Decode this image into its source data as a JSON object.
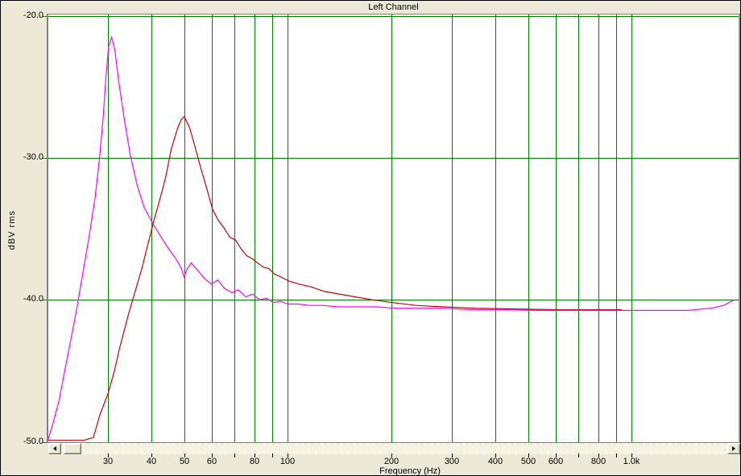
{
  "window": {
    "title": "Left Channel"
  },
  "colors": {
    "background": "#ece9d8",
    "plot_background": "#ffffff",
    "grid": "#008000",
    "frame": "#808080",
    "trace_magenta": "#ff00ff",
    "trace_red": "#cc0000",
    "text": "#000000"
  },
  "axes": {
    "y_label": "dBV rms",
    "x_label": "Frequency (Hz)",
    "y_ticks": [
      {
        "value": -20,
        "label": "-20.0"
      },
      {
        "value": -30,
        "label": "-30.0"
      },
      {
        "value": -40,
        "label": "-40.0"
      },
      {
        "value": -50,
        "label": "-50.0"
      }
    ],
    "x_gridlines": [
      30,
      40,
      50,
      60,
      70,
      80,
      90,
      100,
      200,
      300,
      400,
      500,
      600,
      700,
      800,
      900,
      1000
    ],
    "x_tick_labels": [
      {
        "f": 30,
        "label": "30"
      },
      {
        "f": 40,
        "label": "40"
      },
      {
        "f": 50,
        "label": "50"
      },
      {
        "f": 60,
        "label": "60"
      },
      {
        "f": 80,
        "label": "80"
      },
      {
        "f": 100,
        "label": "100"
      },
      {
        "f": 200,
        "label": "200"
      },
      {
        "f": 300,
        "label": "300"
      },
      {
        "f": 400,
        "label": "400"
      },
      {
        "f": 500,
        "label": "500"
      },
      {
        "f": 600,
        "label": "600"
      },
      {
        "f": 800,
        "label": "800"
      },
      {
        "f": 1000,
        "label": "1.0k"
      }
    ]
  },
  "scrollbar": {
    "left_arrow_icon": "scrollbar-left-arrow-icon",
    "right_arrow_icon": "scrollbar-right-arrow-icon"
  },
  "chart_data": {
    "type": "line",
    "title": "Left Channel",
    "xlabel": "Frequency (Hz)",
    "ylabel": "dBV rms",
    "xscale": "log",
    "xlim": [
      20,
      2000
    ],
    "ylim": [
      -50,
      -20
    ],
    "grid": true,
    "series": [
      {
        "name": "red-trace (50 Hz peak)",
        "color": "#cc0000",
        "points": [
          [
            20,
            -49.9
          ],
          [
            23,
            -49.9
          ],
          [
            25.5,
            -49.9
          ],
          [
            27.2,
            -49.7
          ],
          [
            28.4,
            -48.1
          ],
          [
            30,
            -46.6
          ],
          [
            31.3,
            -45.0
          ],
          [
            32.4,
            -43.4
          ],
          [
            34.4,
            -41.0
          ],
          [
            37.6,
            -37.8
          ],
          [
            40.6,
            -34.6
          ],
          [
            43,
            -32.4
          ],
          [
            44.1,
            -31.4
          ],
          [
            45.8,
            -29.4
          ],
          [
            47.8,
            -27.9
          ],
          [
            49,
            -27.3
          ],
          [
            50,
            -27.1
          ],
          [
            51.8,
            -27.9
          ],
          [
            53.5,
            -29.1
          ],
          [
            55.6,
            -30.6
          ],
          [
            58,
            -32.1
          ],
          [
            60.3,
            -33.6
          ],
          [
            62.7,
            -34.4
          ],
          [
            65,
            -34.9
          ],
          [
            67.8,
            -35.6
          ],
          [
            70.5,
            -35.8
          ],
          [
            73,
            -36.4
          ],
          [
            75.9,
            -36.9
          ],
          [
            78.7,
            -37.1
          ],
          [
            81.5,
            -37.4
          ],
          [
            84.7,
            -37.7
          ],
          [
            88,
            -37.8
          ],
          [
            91.5,
            -38.2
          ],
          [
            95.5,
            -38.4
          ],
          [
            101,
            -38.7
          ],
          [
            108,
            -38.9
          ],
          [
            117,
            -39.1
          ],
          [
            127,
            -39.4
          ],
          [
            141,
            -39.6
          ],
          [
            157,
            -39.8
          ],
          [
            176,
            -40.0
          ],
          [
            201,
            -40.2
          ],
          [
            236,
            -40.4
          ],
          [
            283,
            -40.5
          ],
          [
            351,
            -40.6
          ],
          [
            458,
            -40.65
          ],
          [
            600,
            -40.7
          ],
          [
            787,
            -40.7
          ],
          [
            935,
            -40.7
          ]
        ]
      },
      {
        "name": "magenta-trace (30 Hz peak)",
        "color": "#ff00ff",
        "points": [
          [
            20,
            -50.0
          ],
          [
            20.8,
            -48.6
          ],
          [
            21.6,
            -47.1
          ],
          [
            22.4,
            -45.1
          ],
          [
            23.3,
            -43.0
          ],
          [
            24.3,
            -40.7
          ],
          [
            25.3,
            -38.2
          ],
          [
            26.4,
            -35.6
          ],
          [
            27.5,
            -32.8
          ],
          [
            28.3,
            -30.1
          ],
          [
            29.0,
            -27.3
          ],
          [
            29.6,
            -24.2
          ],
          [
            30.1,
            -22.2
          ],
          [
            30.7,
            -21.5
          ],
          [
            31.4,
            -22.4
          ],
          [
            32.2,
            -24.6
          ],
          [
            33.4,
            -27.2
          ],
          [
            34.8,
            -29.8
          ],
          [
            36.4,
            -31.9
          ],
          [
            38.2,
            -33.5
          ],
          [
            40.4,
            -34.6
          ],
          [
            42.8,
            -35.6
          ],
          [
            45.3,
            -36.5
          ],
          [
            47.5,
            -37.2
          ],
          [
            49.0,
            -37.8
          ],
          [
            49.9,
            -38.4
          ],
          [
            51.0,
            -37.8
          ],
          [
            52.3,
            -37.4
          ],
          [
            54.5,
            -37.9
          ],
          [
            57.2,
            -38.5
          ],
          [
            59.9,
            -38.9
          ],
          [
            62.5,
            -38.6
          ],
          [
            65.4,
            -39.2
          ],
          [
            68.8,
            -39.5
          ],
          [
            71.8,
            -39.3
          ],
          [
            75.4,
            -39.8
          ],
          [
            79.1,
            -39.6
          ],
          [
            82.6,
            -40.0
          ],
          [
            86.6,
            -39.9
          ],
          [
            90.8,
            -40.2
          ],
          [
            95.2,
            -40.1
          ],
          [
            100,
            -40.3
          ],
          [
            107,
            -40.3
          ],
          [
            115,
            -40.4
          ],
          [
            126,
            -40.4
          ],
          [
            140,
            -40.5
          ],
          [
            158,
            -40.5
          ],
          [
            180,
            -40.5
          ],
          [
            207,
            -40.6
          ],
          [
            240,
            -40.6
          ],
          [
            283,
            -40.6
          ],
          [
            340,
            -40.7
          ],
          [
            420,
            -40.7
          ],
          [
            530,
            -40.75
          ],
          [
            680,
            -40.75
          ],
          [
            880,
            -40.75
          ],
          [
            1150,
            -40.75
          ],
          [
            1450,
            -40.75
          ],
          [
            1700,
            -40.6
          ],
          [
            1850,
            -40.4
          ],
          [
            1950,
            -40.1
          ],
          [
            2000,
            -40.0
          ]
        ]
      }
    ]
  }
}
